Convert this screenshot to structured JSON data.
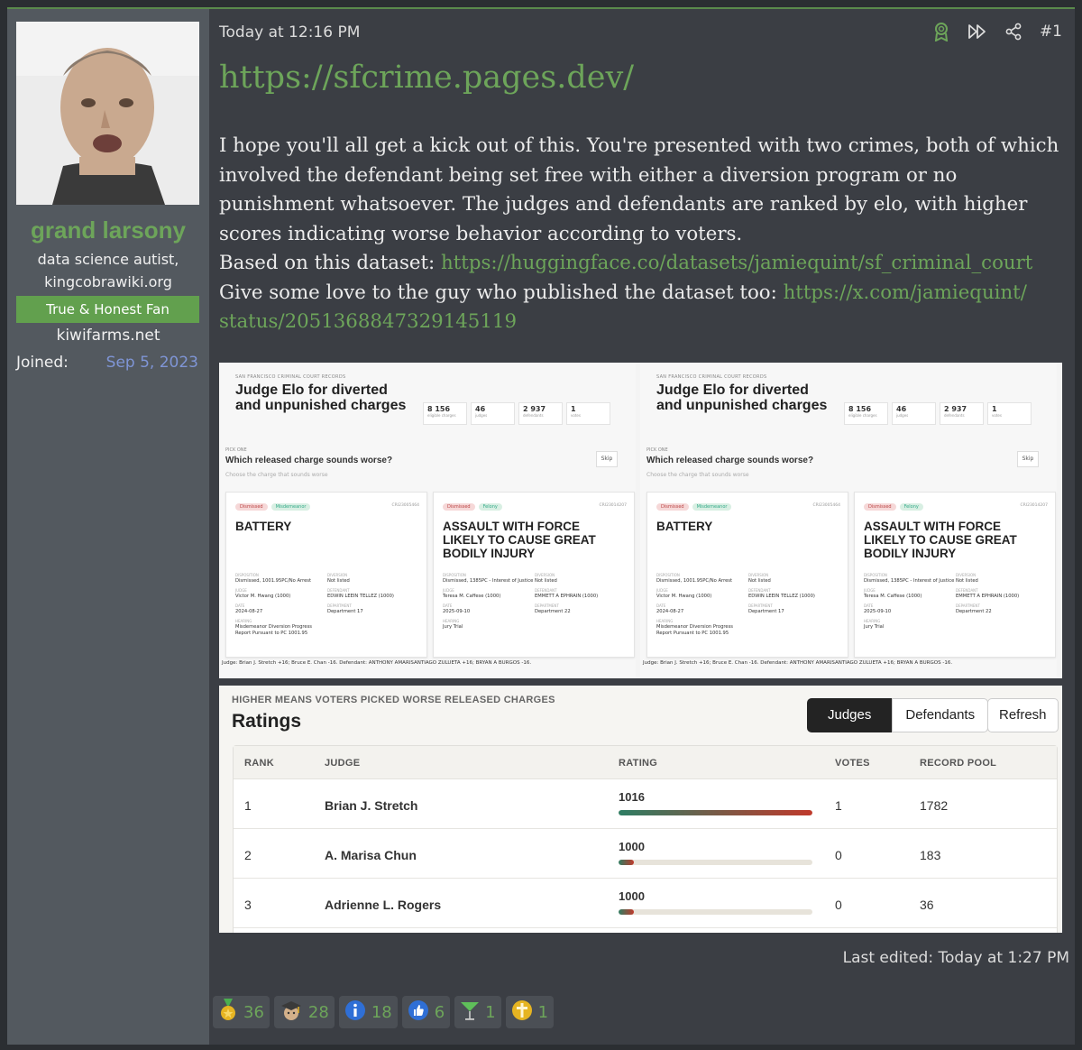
{
  "user": {
    "name": "grand larsony",
    "title_line1": "data science autist,",
    "title_line2": "kingcobrawiki.org",
    "banner": "True & Honest Fan",
    "site": "kiwifarms.net",
    "joined_label": "Joined:",
    "joined_value": "Sep 5, 2023"
  },
  "post": {
    "timestamp": "Today at 12:16 PM",
    "post_number": "#1",
    "big_link": "https://sfcrime.pages.dev/",
    "paragraph": "I hope you'll all get a kick out of this. You're presented with two crimes, both of which involved the defendant being set free with either a diversion program or no punishment whatsoever. The judges and defendants are ranked by elo, with higher scores indicating worse behavior according to voters.",
    "dataset_prefix": "Based on this dataset: ",
    "dataset_link": "https://huggingface.co/datasets/jamiequint/sf_criminal_court",
    "love_prefix": "Give some love to the guy who published the dataset too: ",
    "love_link": "https://x.com/jamiequint/status/2051368847329145119",
    "love_link_line1": "https://x.com/jamiequint/",
    "love_link_line2": "status/2051368847329145119",
    "last_edited": "Last edited: Today at 1:27 PM"
  },
  "screenshot1": {
    "kicker": "SAN FRANCISCO CRIMINAL COURT RECORDS",
    "title": "Judge Elo for diverted and unpunished charges",
    "stats": [
      {
        "value": "8 156",
        "label": "eligible charges"
      },
      {
        "value": "46",
        "label": "judges"
      },
      {
        "value": "2 937",
        "label": "defendants"
      },
      {
        "value": "1",
        "label": "votes"
      }
    ],
    "pick_kicker": "PICK ONE",
    "question": "Which released charge sounds worse?",
    "question_sub": "Choose the charge that sounds worse",
    "skip": "Skip",
    "card1": {
      "tag1": "Dismissed",
      "tag2": "Misdemeanor",
      "case_no": "CRI23005464",
      "charge": "BATTERY",
      "disposition_label": "DISPOSITION",
      "disposition": "Dismissed, 1001.95PC/No Arrest",
      "diversion_label": "DIVERSION",
      "diversion": "Not listed",
      "judge_label": "JUDGE",
      "judge": "Victor M. Hwang (1000)",
      "defendant_label": "DEFENDANT",
      "defendant": "EDWIN LEEIN TELLEZ (1000)",
      "date_label": "DATE",
      "date": "2024-08-27",
      "department_label": "DEPARTMENT",
      "department": "Department 17",
      "hearing_label": "HEARING",
      "hearing": "Misdemeanor Diversion Progress Report Pursuant to PC 1001.95"
    },
    "card2": {
      "tag1": "Dismissed",
      "tag2": "Felony",
      "case_no": "CRI23014207",
      "charge": "ASSAULT WITH FORCE LIKELY TO CAUSE GREAT BODILY INJURY",
      "disposition_label": "DISPOSITION",
      "disposition": "Dismissed, 1385PC - Interest of Justice",
      "diversion_label": "DIVERSION",
      "diversion": "Not listed",
      "judge_label": "JUDGE",
      "judge": "Teresa M. Caffese (1000)",
      "defendant_label": "DEFENDANT",
      "defendant": "EMMETT A EPHRAIN (1000)",
      "date_label": "DATE",
      "date": "2025-09-10",
      "department_label": "DEPARTMENT",
      "department": "Department 22",
      "hearing_label": "HEARING",
      "hearing": "Jury Trial"
    },
    "footer": "Judge: Brian J. Stretch +16; Bruce E. Chan -16. Defendant: ANTHONY AMARISANTIAGO ZULUETA +16; BRYAN A BURGOS -16."
  },
  "ratings": {
    "kicker": "HIGHER MEANS VOTERS PICKED WORSE RELEASED CHARGES",
    "title": "Ratings",
    "tabs": [
      "Judges",
      "Defendants"
    ],
    "refresh": "Refresh",
    "columns": [
      "RANK",
      "JUDGE",
      "RATING",
      "VOTES",
      "RECORD POOL"
    ],
    "rows": [
      {
        "rank": "1",
        "judge": "Brian J. Stretch",
        "rating": "1016",
        "votes": "1",
        "pool": "1782",
        "bar_fraction": 1.0
      },
      {
        "rank": "2",
        "judge": "A. Marisa Chun",
        "rating": "1000",
        "votes": "0",
        "pool": "183",
        "bar_fraction": 0.08
      },
      {
        "rank": "3",
        "judge": "Adrienne L. Rogers",
        "rating": "1000",
        "votes": "0",
        "pool": "36",
        "bar_fraction": 0.08
      }
    ]
  },
  "reactions": [
    {
      "icon": "medal-icon",
      "count": "36"
    },
    {
      "icon": "graduate-icon",
      "count": "28"
    },
    {
      "icon": "informative-icon",
      "count": "18"
    },
    {
      "icon": "thumbs-up-icon",
      "count": "6"
    },
    {
      "icon": "martini-icon",
      "count": "1"
    },
    {
      "icon": "cross-icon",
      "count": "1"
    }
  ],
  "colors": {
    "accent": "#6da55a",
    "link_blue": "#7f95d6",
    "bar_green": "#2e7d63",
    "bar_red": "#c0392b"
  }
}
